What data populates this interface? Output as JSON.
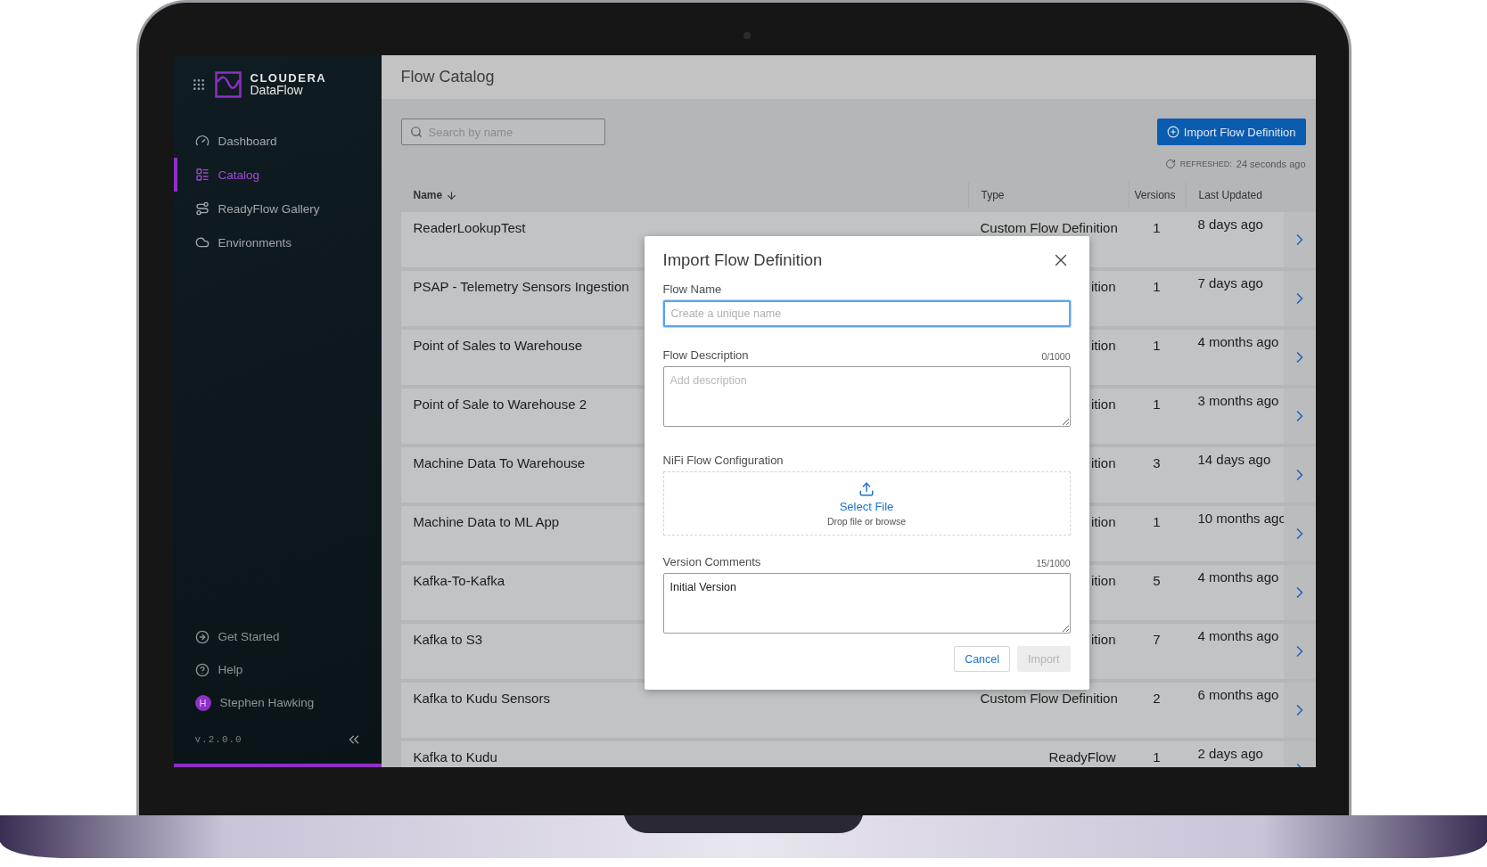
{
  "sidebar": {
    "logo": {
      "brand": "CLOUDERA",
      "product": "DataFlow"
    },
    "nav": [
      {
        "label": "Dashboard",
        "selected": false
      },
      {
        "label": "Catalog",
        "selected": true
      },
      {
        "label": "ReadyFlow Gallery",
        "selected": false
      },
      {
        "label": "Environments",
        "selected": false
      }
    ],
    "footer": [
      {
        "label": "Get Started"
      },
      {
        "label": "Help"
      }
    ],
    "user": {
      "initial": "H",
      "name": "Stephen Hawking"
    },
    "version": "v.2.0.0"
  },
  "page": {
    "title": "Flow Catalog",
    "search": {
      "placeholder": "Search by name"
    },
    "import_button": "Import Flow Definition",
    "refreshed": {
      "label": "REFRESHED:",
      "value": "24 seconds ago"
    }
  },
  "table": {
    "columns": [
      {
        "label": "Name",
        "sorted": true
      },
      {
        "label": "Type",
        "sorted": false
      },
      {
        "label": "Versions",
        "sorted": false
      },
      {
        "label": "Last Updated",
        "sorted": false
      }
    ],
    "rows": [
      {
        "name": "ReaderLookupTest",
        "type": "Custom Flow Definition",
        "versions": "1",
        "updated": "8 days ago"
      },
      {
        "name": "PSAP - Telemetry Sensors Ingestion",
        "type": "ition",
        "versions": "1",
        "updated": "7 days ago"
      },
      {
        "name": "Point of Sales to Warehouse",
        "type": "ition",
        "versions": "1",
        "updated": "4 months ago"
      },
      {
        "name": "Point of Sale to Warehouse 2",
        "type": "ition",
        "versions": "1",
        "updated": "3 months ago"
      },
      {
        "name": "Machine Data To Warehouse",
        "type": "ition",
        "versions": "3",
        "updated": "14 days ago"
      },
      {
        "name": "Machine Data to ML App",
        "type": "ition",
        "versions": "1",
        "updated": "10 months ago"
      },
      {
        "name": "Kafka-To-Kafka",
        "type": "ition",
        "versions": "5",
        "updated": "4 months ago"
      },
      {
        "name": "Kafka to S3",
        "type": "ition",
        "versions": "7",
        "updated": "4 months ago"
      },
      {
        "name": "Kafka to Kudu Sensors",
        "type": "Custom Flow Definition",
        "versions": "2",
        "updated": "6 months ago"
      },
      {
        "name": "Kafka to Kudu",
        "type": "ReadyFlow",
        "versions": "1",
        "updated": "2 days ago"
      }
    ]
  },
  "dialog": {
    "title": "Import Flow Definition",
    "fields": [
      {
        "kind": "input",
        "label": "Flow Name",
        "placeholder": "Create a unique name",
        "focused": true
      },
      {
        "kind": "textarea",
        "label": "Flow Description",
        "counter": "0/1000",
        "placeholder": "Add description",
        "focused": false
      },
      {
        "kind": "upload",
        "label": "NiFi Flow Configuration",
        "action": "Select File",
        "hint": "Drop file or browse"
      },
      {
        "kind": "textarea",
        "label": "Version Comments",
        "counter": "15/1000",
        "value": "Initial Version",
        "focused": false
      }
    ],
    "buttons": [
      {
        "label": "Cancel",
        "disabled": false
      },
      {
        "label": "Import",
        "disabled": true
      }
    ]
  }
}
